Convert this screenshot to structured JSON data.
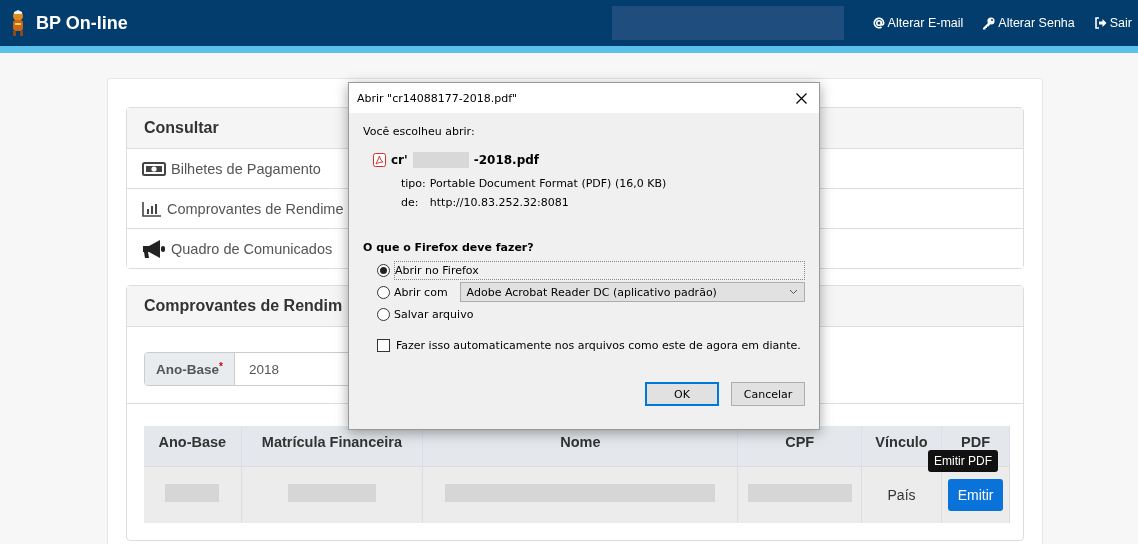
{
  "navbar": {
    "title": "BP On-line",
    "links": [
      {
        "kind": "email",
        "label": "Alterar E-mail"
      },
      {
        "kind": "password",
        "label": "Alterar Senha"
      },
      {
        "kind": "logout",
        "label": "Sair"
      }
    ]
  },
  "consult_panel": {
    "heading": "Consultar",
    "items": [
      {
        "kind": "bill",
        "label": "Bilhetes de Pagamento"
      },
      {
        "kind": "chart",
        "label": "Comprovantes de Rendime"
      },
      {
        "kind": "megaphone",
        "label": "Quadro de Comunicados"
      }
    ]
  },
  "report_panel": {
    "heading": "Comprovantes de Rendim",
    "year_field": {
      "label": "Ano-Base",
      "required_mark": "*",
      "value": "2018"
    }
  },
  "table": {
    "columns": [
      "Ano-Base",
      "Matrícula Financeira",
      "Nome",
      "CPF",
      "Vínculo",
      "PDF"
    ],
    "rows": [
      [
        {
          "kind": "redacted"
        },
        {
          "kind": "redacted"
        },
        {
          "kind": "redacted"
        },
        {
          "kind": "redacted"
        },
        {
          "kind": "text",
          "text": "País"
        },
        {
          "kind": "button",
          "text": "Emitir"
        }
      ]
    ]
  },
  "tooltip": "Emitir PDF",
  "dialog": {
    "title": "Abrir \"cr14088177-2018.pdf\"",
    "intro": "Você escolheu abrir:",
    "file_start": "cr'",
    "file_end": "-2018.pdf",
    "type_label": "tipo:",
    "type_value": "Portable Document Format (PDF) (16,0 KB)",
    "from_label": "de:",
    "from_value": "http://10.83.252.32:8081",
    "question": "O que o Firefox deve fazer?",
    "options": [
      {
        "kind": "plain",
        "label": "Abrir no Firefox",
        "selected": true
      },
      {
        "kind": "app",
        "label": "Abrir com",
        "app": "Adobe Acrobat Reader DC (aplicativo padrão)",
        "selected": false
      },
      {
        "kind": "plain",
        "label": "Salvar arquivo",
        "selected": false
      }
    ],
    "remember": {
      "label": "Fazer isso automaticamente nos arquivos como este de agora em diante.",
      "checked": false
    },
    "buttons": [
      {
        "label": "OK",
        "kind": "primary"
      },
      {
        "label": "Cancelar",
        "kind": "secondary"
      }
    ]
  }
}
